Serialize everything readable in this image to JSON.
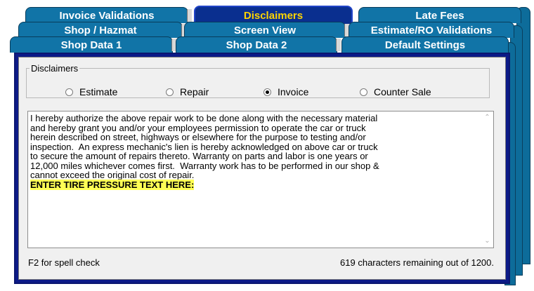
{
  "tabs_row1": [
    {
      "label": "Invoice Validations"
    },
    {
      "label": "Disclaimers",
      "selected": true
    },
    {
      "label": "Late Fees"
    }
  ],
  "tabs_row2": [
    {
      "label": "Shop / Hazmat"
    },
    {
      "label": "Screen View"
    },
    {
      "label": "Estimate/RO Validations"
    }
  ],
  "tabs_row3": [
    {
      "label": "Shop Data 1"
    },
    {
      "label": "Shop Data 2"
    },
    {
      "label": "Default Settings"
    }
  ],
  "disclaimers": {
    "group_label": "Disclaimers",
    "options": [
      {
        "label": "Estimate",
        "checked": false
      },
      {
        "label": "Repair",
        "checked": false
      },
      {
        "label": "Invoice",
        "checked": true
      },
      {
        "label": "Counter Sale",
        "checked": false
      }
    ],
    "body_text": "I hereby authorize the above repair work to be done along with the necessary material\nand hereby grant you and/or your employees permission to operate the car or truck\nherein described on street, highways or elsewhere for the purpose to testing and/or\ninspection.  An express mechanic's lien is hereby acknowledged on above car or truck\nto secure the amount of repairs thereto. Warranty on parts and labor is one years or\n12,000 miles whichever comes first.  Warranty work has to be performed in our shop &\ncannot exceed the original cost of repair.",
    "highlight_text": "ENTER TIRE PRESSURE TEXT HERE:",
    "spell_check_hint": "F2 for spell check",
    "chars_remaining": "619 characters remaining out of 1200."
  },
  "colors": {
    "tab_bg": "#1174a7",
    "tab_selected_bg": "#0a2f8f",
    "tab_selected_text": "#ffd400",
    "panel_border": "#0c1a88",
    "highlight": "#ffff55"
  }
}
